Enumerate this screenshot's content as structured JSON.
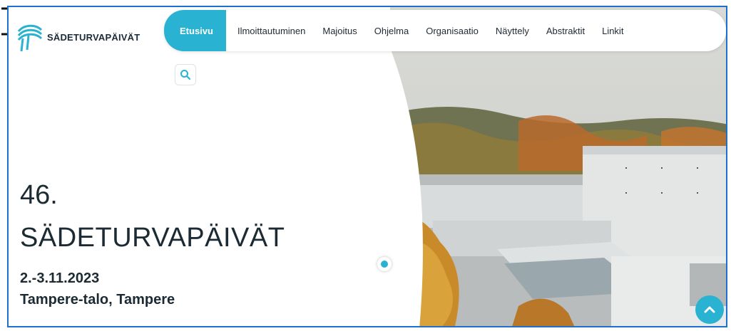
{
  "site": {
    "logo_text": "SÄDETURVAPÄIVÄT"
  },
  "nav": {
    "items": [
      {
        "label": "Etusivu",
        "active": true
      },
      {
        "label": "Ilmoittautuminen"
      },
      {
        "label": "Majoitus"
      },
      {
        "label": "Ohjelma"
      },
      {
        "label": "Organisaatio"
      },
      {
        "label": "Näyttely"
      },
      {
        "label": "Abstraktit"
      },
      {
        "label": "Linkit"
      }
    ]
  },
  "search": {
    "icon": "search-icon"
  },
  "hero": {
    "number": "46.",
    "title": "SÄDETURVAPÄIVÄT",
    "date": "2.-3.11.2023",
    "venue": "Tampere-talo, Tampere"
  },
  "colors": {
    "accent": "#29b2d1",
    "text": "#1c2b33",
    "frame": "#1f6fd0"
  }
}
